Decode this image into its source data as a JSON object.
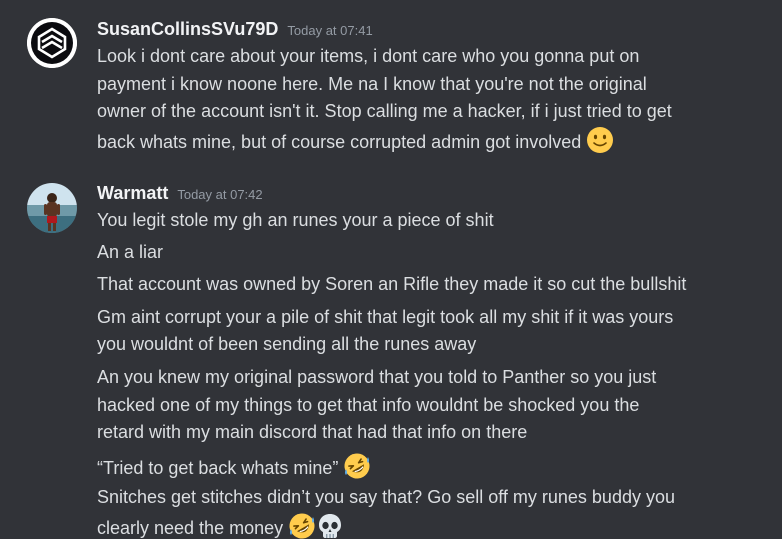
{
  "messages": [
    {
      "author": "SusanCollinsSVu79D",
      "timestamp": "Today at 07:41",
      "avatar_icon": "stacked-chevrons-logo-icon",
      "lines": [
        "Look i dont care about your items, i dont care who you gonna put on",
        "payment i know noone here. Me na I know that you're not the original",
        "owner of the account isn't it. Stop calling me a hacker, if i just tried to get",
        "back whats mine, but of course corrupted admin got involved"
      ],
      "emojis": [
        "slightly-smiling-face-icon"
      ]
    },
    {
      "author": "Warmatt",
      "timestamp": "Today at 07:42",
      "avatar_icon": "user-photo-avatar",
      "lines": [
        "You legit stole my gh an runes your a piece of shit",
        "An a liar",
        "That account was owned by Soren an Rifle they made it so cut the bullshit",
        "Gm aint corrupt your a pile of shit that legit took all my shit if it was yours",
        "you wouldnt of been sending all the runes away",
        "An you knew my original password that you told to Panther so you just",
        "hacked one of my things to get that info wouldnt be shocked you the",
        "retard with my main discord that had that info on there",
        "“Tried to get back whats mine”",
        "Snitches get stitches didn’t you say that? Go sell off my runes buddy you",
        "clearly need the money"
      ],
      "emojis": [
        "rolling-on-floor-laughing-icon",
        "skull-icon"
      ]
    }
  ],
  "colors": {
    "background": "#313338",
    "author": "#f2f3f5",
    "text": "#dbdee1",
    "timestamp": "#949ba4"
  }
}
